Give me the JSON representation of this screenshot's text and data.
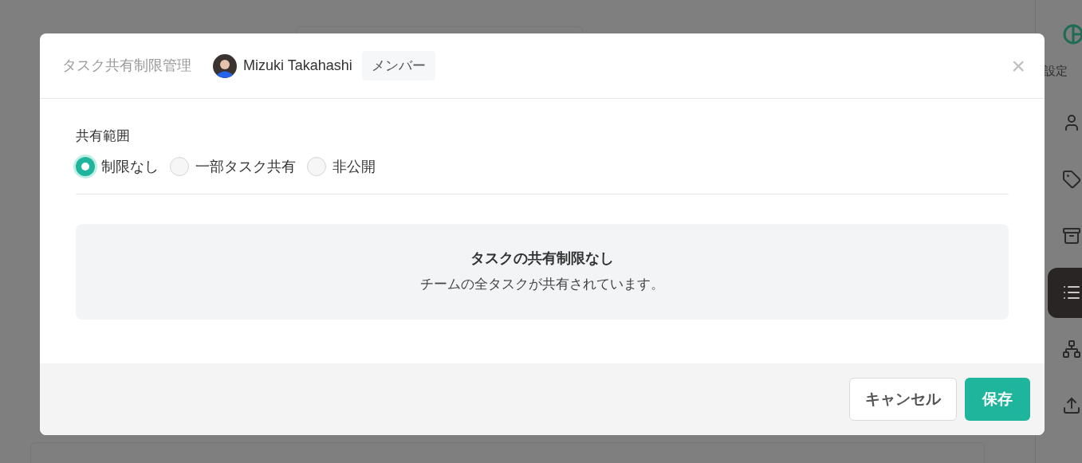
{
  "sidebar": {
    "label": "設定",
    "items": [
      {
        "kind": "user",
        "selected": false
      },
      {
        "kind": "tag",
        "selected": false
      },
      {
        "kind": "box",
        "selected": false
      },
      {
        "kind": "list",
        "selected": true
      },
      {
        "kind": "hierarchy",
        "selected": false
      },
      {
        "kind": "upload",
        "selected": false
      }
    ]
  },
  "modal": {
    "title": "タスク共有制限管理",
    "user_name": "Mizuki Takahashi",
    "role": "メンバー",
    "close": "×",
    "section_label": "共有範囲",
    "options": [
      {
        "label": "制限なし",
        "selected": true
      },
      {
        "label": "一部タスク共有",
        "selected": false
      },
      {
        "label": "非公開",
        "selected": false
      }
    ],
    "info": {
      "title": "タスクの共有制限なし",
      "description": "チームの全タスクが共有されています。"
    },
    "buttons": [
      {
        "kind": "secondary",
        "label": "キャンセル"
      },
      {
        "kind": "primary",
        "label": "保存"
      }
    ]
  }
}
